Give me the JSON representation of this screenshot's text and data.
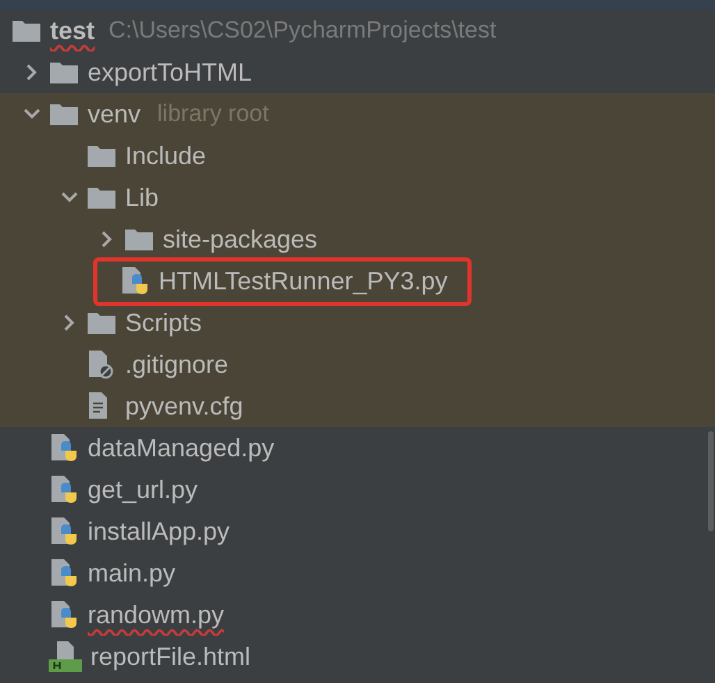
{
  "tree": {
    "name": "test",
    "kind": "folder",
    "path": "C:\\Users\\CS02\\PycharmProjects\\test",
    "misspelled": true,
    "children": [
      {
        "name": "exportToHTML",
        "kind": "folder",
        "expanded": false
      },
      {
        "name": "venv",
        "kind": "folder",
        "note": "library root",
        "expanded": true,
        "library_root": true,
        "children": [
          {
            "name": "Include",
            "kind": "folder"
          },
          {
            "name": "Lib",
            "kind": "folder",
            "expanded": true,
            "children": [
              {
                "name": "site-packages",
                "kind": "folder",
                "expanded": false
              },
              {
                "name": "HTMLTestRunner_PY3.py",
                "kind": "python",
                "highlighted": true
              }
            ]
          },
          {
            "name": "Scripts",
            "kind": "folder",
            "expanded": false
          },
          {
            "name": ".gitignore",
            "kind": "ignore"
          },
          {
            "name": "pyvenv.cfg",
            "kind": "text"
          }
        ]
      },
      {
        "name": "dataManaged.py",
        "kind": "python"
      },
      {
        "name": "get_url.py",
        "kind": "python"
      },
      {
        "name": "installApp.py",
        "kind": "python"
      },
      {
        "name": "main.py",
        "kind": "python"
      },
      {
        "name": "randowm.py",
        "kind": "python",
        "misspelled": true
      },
      {
        "name": "reportFile.html",
        "kind": "html"
      }
    ]
  }
}
